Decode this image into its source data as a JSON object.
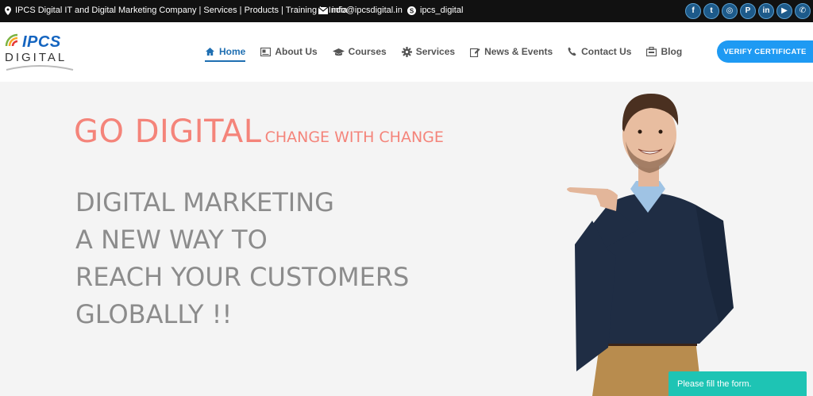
{
  "topbar": {
    "company": "IPCS Digital IT and Digital Marketing Company | Services | Products | Training in India",
    "email": "info@ipcsdigital.in",
    "skype": "ipcs_digital",
    "socials": [
      {
        "name": "facebook-icon",
        "glyph": "f"
      },
      {
        "name": "twitter-icon",
        "glyph": "t"
      },
      {
        "name": "instagram-icon",
        "glyph": "◎"
      },
      {
        "name": "pinterest-icon",
        "glyph": "P"
      },
      {
        "name": "linkedin-icon",
        "glyph": "in"
      },
      {
        "name": "youtube-icon",
        "glyph": "▶"
      },
      {
        "name": "whatsapp-icon",
        "glyph": "✆"
      }
    ]
  },
  "logo": {
    "top": "IPCS",
    "bottom": "DIGITAL"
  },
  "nav": {
    "home": "Home",
    "about": "About Us",
    "courses": "Courses",
    "services": "Services",
    "news": "News & Events",
    "contact": "Contact Us",
    "blog": "Blog"
  },
  "verify_label": "VERIFY CERTIFICATE",
  "hero": {
    "go_big": "GO DIGITAL",
    "go_small": "CHANGE WITH CHANGE",
    "line1": "DIGITAL MARKETING",
    "line2": "A NEW WAY TO",
    "line3": "REACH YOUR CUSTOMERS",
    "line4": "GLOBALLY !!"
  },
  "form_label": "Please fill the form.",
  "colors": {
    "accent": "#1f6fb2",
    "verify": "#1e9af3",
    "salmon": "#f4847a",
    "teal": "#1ec4b4"
  }
}
